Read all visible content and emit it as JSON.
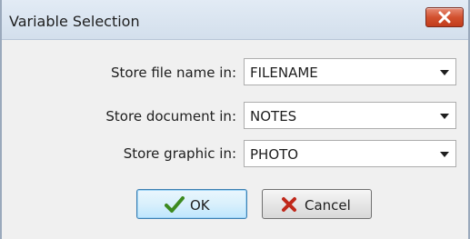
{
  "window": {
    "title": "Variable Selection"
  },
  "fields": [
    {
      "label": "Store file name in:",
      "value": "FILENAME"
    },
    {
      "label": "Store document in:",
      "value": "NOTES"
    },
    {
      "label": "Store graphic in:",
      "value": "PHOTO"
    }
  ],
  "buttons": {
    "ok_label": "OK",
    "cancel_label": "Cancel"
  },
  "icons": {
    "close": "close-icon",
    "ok": "checkmark-icon",
    "cancel": "x-icon"
  },
  "colors": {
    "close_button": "#c8482a",
    "ok_check": "#3d8a1f",
    "cancel_x": "#c0281a",
    "ok_border": "#3c7fb1"
  }
}
